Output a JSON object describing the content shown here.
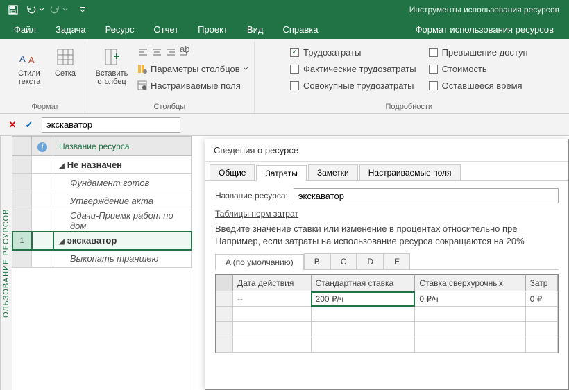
{
  "qat": {
    "title": "Инструменты использования ресурсов"
  },
  "tabs": {
    "file": "Файл",
    "task": "Задача",
    "resource": "Ресурс",
    "report": "Отчет",
    "project": "Проект",
    "view": "Вид",
    "help": "Справка",
    "format": "Формат использования ресурсов"
  },
  "ribbon": {
    "format_group": "Формат",
    "columns_group": "Столбцы",
    "details_group": "Подробности",
    "text_styles": "Стили текста",
    "grid": "Сетка",
    "insert_column": "Вставить столбец",
    "column_params": "Параметры столбцов",
    "custom_fields": "Настраиваемые поля",
    "chk_work": "Трудозатраты",
    "chk_actual": "Фактические трудозатраты",
    "chk_cumulative": "Совокупные трудозатраты",
    "chk_overalloc": "Превышение доступ",
    "chk_cost": "Стоимость",
    "chk_remaining": "Оставшееся время"
  },
  "namebar": {
    "value": "экскаватор"
  },
  "side_label": "ОЛЬЗОВАНИЕ РЕСУРСОВ",
  "grid": {
    "col_info": "",
    "col_name": "Название ресурса",
    "rows": [
      {
        "type": "summary",
        "name": "Не назначен"
      },
      {
        "type": "task",
        "name": "Фундамент готов"
      },
      {
        "type": "task",
        "name": "Утверждение акта"
      },
      {
        "type": "task",
        "name": "Сдачи-Приемк работ по дом"
      },
      {
        "type": "summary",
        "name": "экскаватор",
        "idx": "1",
        "selected": true
      },
      {
        "type": "task",
        "name": "Выкопать траншею"
      }
    ]
  },
  "dialog": {
    "title": "Сведения о ресурсе",
    "tabs": {
      "general": "Общие",
      "costs": "Затраты",
      "notes": "Заметки",
      "custom": "Настраиваемые поля"
    },
    "name_label": "Название ресурса:",
    "name_value": "экскаватор",
    "tables_label": "Таблицы норм затрат",
    "help1": "Введите значение ставки или изменение в процентах относительно пре",
    "help2": "Например, если затраты на использование ресурса сокращаются на 20%",
    "rate_tabs": {
      "a": "A (по умолчанию)",
      "b": "B",
      "c": "C",
      "d": "D",
      "e": "E"
    },
    "rate_cols": {
      "date": "Дата действия",
      "std": "Стандартная ставка",
      "ovt": "Ставка сверхурочных",
      "per": "Затр"
    },
    "rate_row": {
      "date": "--",
      "std": "200 ₽/ч",
      "ovt": "0 ₽/ч",
      "per": "0 ₽"
    }
  }
}
